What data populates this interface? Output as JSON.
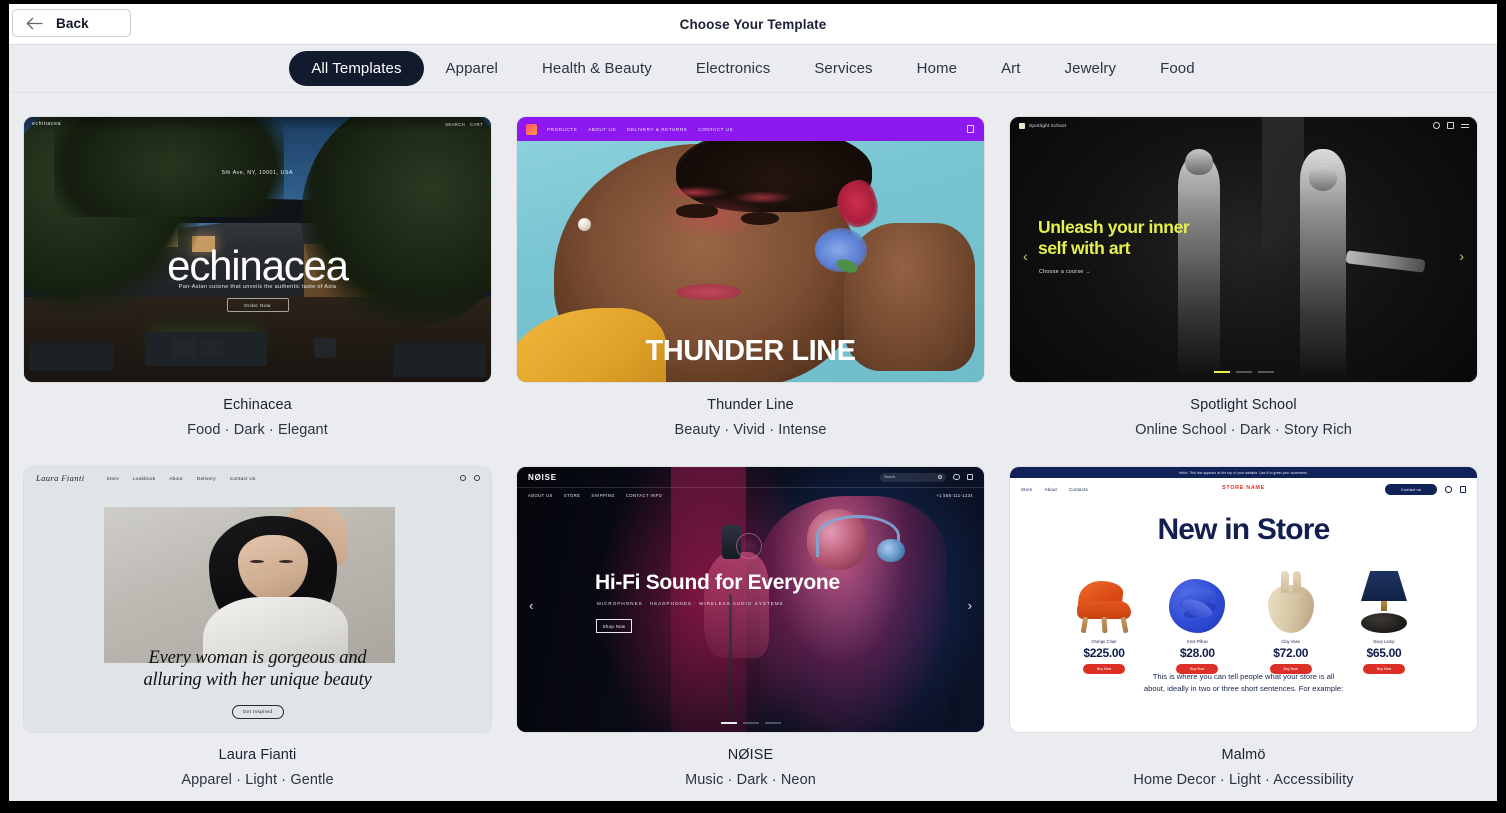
{
  "header": {
    "back_label": "Back",
    "back_icon": "arrow-left-icon",
    "title": "Choose Your Template"
  },
  "categories": [
    {
      "label": "All Templates",
      "active": true
    },
    {
      "label": "Apparel",
      "active": false
    },
    {
      "label": "Health & Beauty",
      "active": false
    },
    {
      "label": "Electronics",
      "active": false
    },
    {
      "label": "Services",
      "active": false
    },
    {
      "label": "Home",
      "active": false
    },
    {
      "label": "Art",
      "active": false
    },
    {
      "label": "Jewelry",
      "active": false
    },
    {
      "label": "Food",
      "active": false
    }
  ],
  "templates": [
    {
      "name": "Echinacea",
      "tags": "Food · Dark · Elegant",
      "preview": {
        "logo": "echinacea",
        "nav_right": [
          "SEARCH",
          "CART"
        ],
        "address": "5th Ave, NY, 10001, USA",
        "title": "echinacea",
        "subtitle": "Pan-Asian cuisine that unveils the authentic taste of Asia",
        "cta": "Order Now"
      }
    },
    {
      "name": "Thunder Line",
      "tags": "Beauty · Vivid · Intense",
      "preview": {
        "nav": [
          "PRODUCTS",
          "ABOUT US",
          "DELIVERY & RETURNS",
          "CONTACT US"
        ],
        "title": "THUNDER LINE",
        "nav_bg": "#8e19f0"
      }
    },
    {
      "name": "Spotlight School",
      "tags": "Online School · Dark · Story Rich",
      "preview": {
        "logo": "Spotlight school",
        "heading_line1": "Unleash your inner",
        "heading_line2": "self with art",
        "link": "Choose a course →",
        "prev": "‹",
        "next": "›",
        "accent": "#e5f24e"
      }
    },
    {
      "name": "Laura Fianti",
      "tags": "Apparel · Light · Gentle",
      "preview": {
        "logo": "Laura Fianti",
        "nav": [
          "Store",
          "Lookbook",
          "About",
          "Delivery",
          "Contact Us"
        ],
        "quote_line1": "Every woman is gorgeous and",
        "quote_line2": "alluring with her unique beauty",
        "cta": "Get Inspired"
      }
    },
    {
      "name": "NØISE",
      "tags": "Music · Dark · Neon",
      "preview": {
        "logo": "NØISE",
        "search_placeholder": "Search",
        "nav": [
          "ABOUT US",
          "STORE",
          "SHIPPING",
          "CONTACT INFO"
        ],
        "phone": "+1 555-111-1234",
        "heading": "Hi-Fi Sound for Everyone",
        "kicker": "MICROPHONES · HEADPHONES · WIRELESS AUDIO SYSTEMS",
        "cta": "Shop Now",
        "prev": "‹",
        "next": "›"
      }
    },
    {
      "name": "Malmö",
      "tags": "Home Decor · Light · Accessibility",
      "preview": {
        "banner": "Hello! This line appears at the top of your website. Use it to greet your customers.",
        "nav": [
          "Store",
          "About",
          "Contacts"
        ],
        "store_name": "STORE NAME",
        "contact_btn": "Contact us",
        "heading": "New in Store",
        "products": [
          {
            "name": "Orange Chair",
            "price": "$225.00",
            "buy": "Buy Now"
          },
          {
            "name": "Knot Pillow",
            "price": "$28.00",
            "buy": "Buy Now"
          },
          {
            "name": "Clay Vase",
            "price": "$72.00",
            "buy": "Buy Now"
          },
          {
            "name": "Navy Lamp",
            "price": "$65.00",
            "buy": "Buy Now"
          }
        ],
        "description_line1": "This is where you can tell people what your store is all",
        "description_line2": "about, ideally in two or three short sentences. For example:"
      }
    }
  ]
}
